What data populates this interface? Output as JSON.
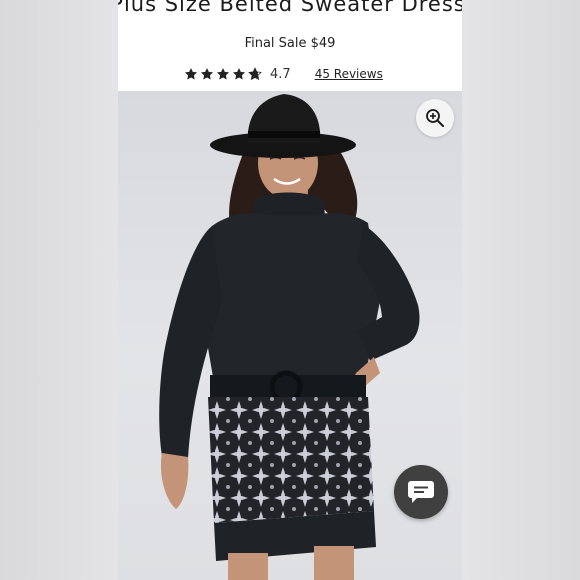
{
  "product": {
    "title": "Plus Size Belted Sweater Dress",
    "price_text": "Final Sale $49",
    "rating": {
      "value": "4.7",
      "stars_filled": 4.7,
      "stars_max": 5,
      "reviews_text": "45 Reviews"
    }
  },
  "image": {
    "alt": "Plus Size Belted Sweater Dress",
    "zoom_icon": "zoom-in-icon"
  },
  "chat": {
    "icon": "chat-bubble-icon"
  },
  "colors": {
    "text": "#1c1c1c",
    "star": "#222222",
    "chat_button": "#404040",
    "background": "#e6e6e8"
  }
}
